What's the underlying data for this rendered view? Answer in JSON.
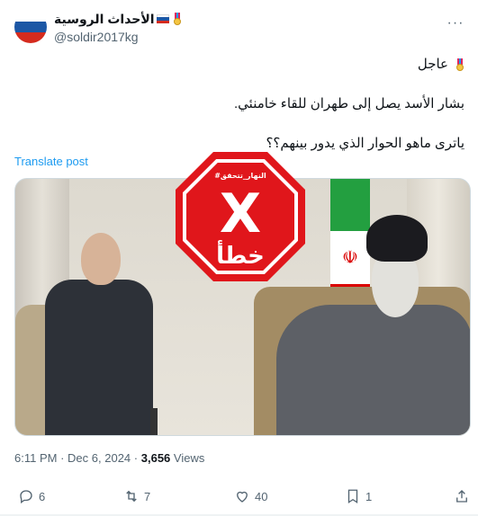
{
  "author": {
    "display_name": "الأحداث الروسية",
    "handle": "@soldir2017kg"
  },
  "tweet": {
    "line1": "عاجل",
    "line2": "بشار الأسد يصل إلى طهران للقاء خامنئي.",
    "line3": "ياترى ماهو الحوار الذي يدور بينهم؟؟",
    "translate_label": "Translate post"
  },
  "stamp": {
    "tag": "#النهار_تتحقق",
    "verdict": "خطأ",
    "mark": "X",
    "color": "#e0161b"
  },
  "meta": {
    "time": "6:11 PM",
    "separator": "·",
    "date": "Dec 6, 2024",
    "views_count": "3,656",
    "views_label": "Views"
  },
  "actions": {
    "replies": "6",
    "reposts": "7",
    "likes": "40",
    "bookmarks": "1"
  },
  "icons": [
    "more-icon",
    "reply-icon",
    "repost-icon",
    "like-icon",
    "bookmark-icon",
    "share-icon",
    "medal-icon",
    "russia-flag-icon"
  ]
}
